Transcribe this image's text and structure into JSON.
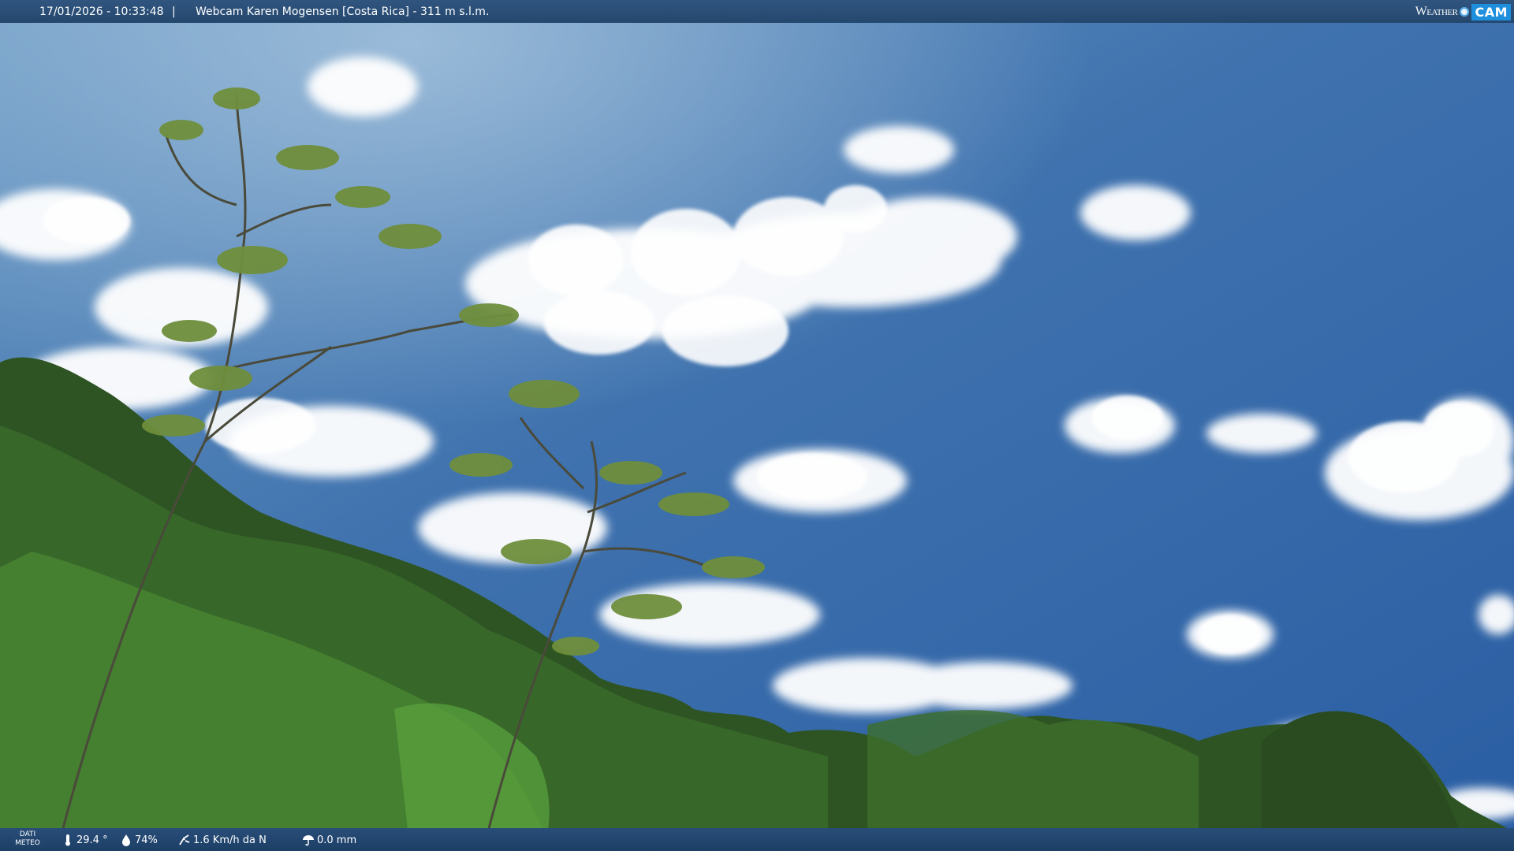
{
  "header": {
    "timestamp": "17/01/2026 - 10:33:48",
    "separator": "|",
    "camera_title": "Webcam Karen Mogensen [Costa Rica]  - 311 m s.l.m.",
    "logo": {
      "word": "Weather",
      "cam": "CAM"
    }
  },
  "footer": {
    "label_line1": "DATI",
    "label_line2": "METEO",
    "temperature": "29.4 °",
    "humidity": "74%",
    "wind": "1.6 Km/h da N",
    "rain": "0.0 mm",
    "icons": [
      "thermometer-icon",
      "humidity-drop-icon",
      "wind-icon",
      "rain-icon"
    ]
  },
  "colors": {
    "sky_top": "#2f5f99",
    "sky_bottom": "#6e9fd0",
    "vegetation": "#2e5a22",
    "bar": "#24476d"
  }
}
